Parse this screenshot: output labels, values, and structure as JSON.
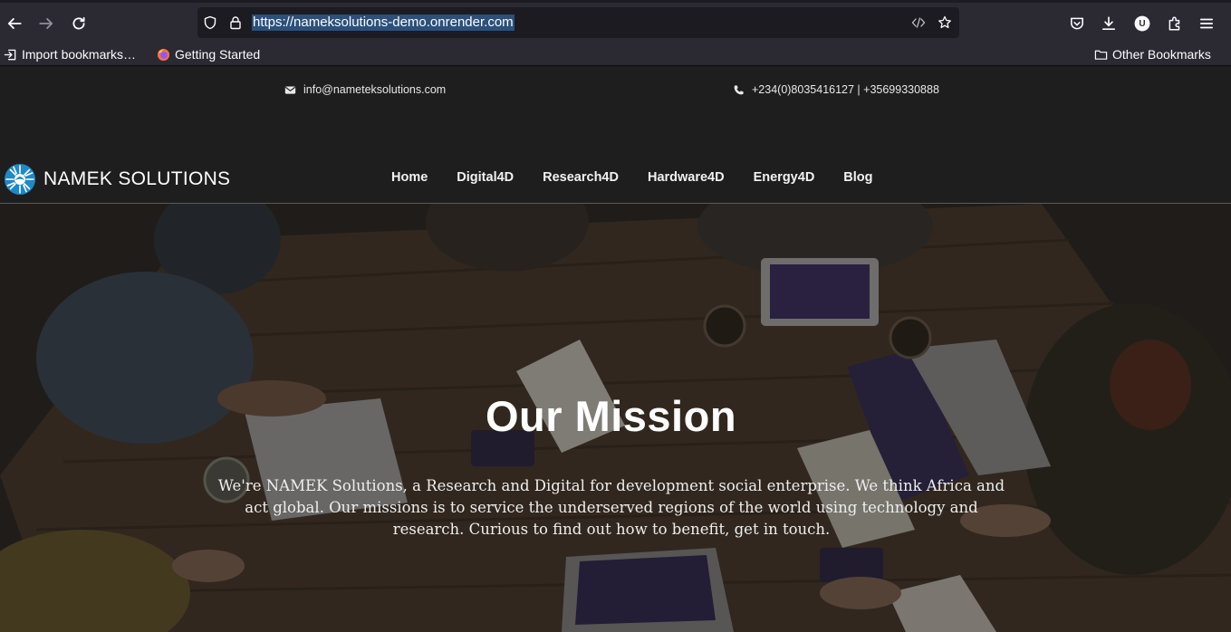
{
  "browser": {
    "url_host": "https://nameksolutions-demo.onrender.com",
    "bookmarks": [
      {
        "label": "Import bookmarks…",
        "icon": "import-icon"
      },
      {
        "label": "Getting Started",
        "icon": "firefox-icon"
      }
    ],
    "other_bookmarks": "Other Bookmarks",
    "account_initial": "U"
  },
  "site": {
    "email": "info@nameteksolutions.com",
    "phone": "+234(0)8035416127 | +35699330888",
    "brand": "NAMEK SOLUTIONS",
    "nav": [
      "Home",
      "Digital4D",
      "Research4D",
      "Hardware4D",
      "Energy4D",
      "Blog"
    ],
    "hero": {
      "title": "Our Mission",
      "text": "We're NAMEK Solutions, a Research and Digital for development social enterprise. We think Africa and act global. Our missions is to service the underserved regions of the world using technology and research. Curious to find out how to benefit, get in touch."
    }
  },
  "colors": {
    "chrome": "#2b2a33",
    "page_bg": "#1e1e1f",
    "accent": "#45a1ff"
  }
}
